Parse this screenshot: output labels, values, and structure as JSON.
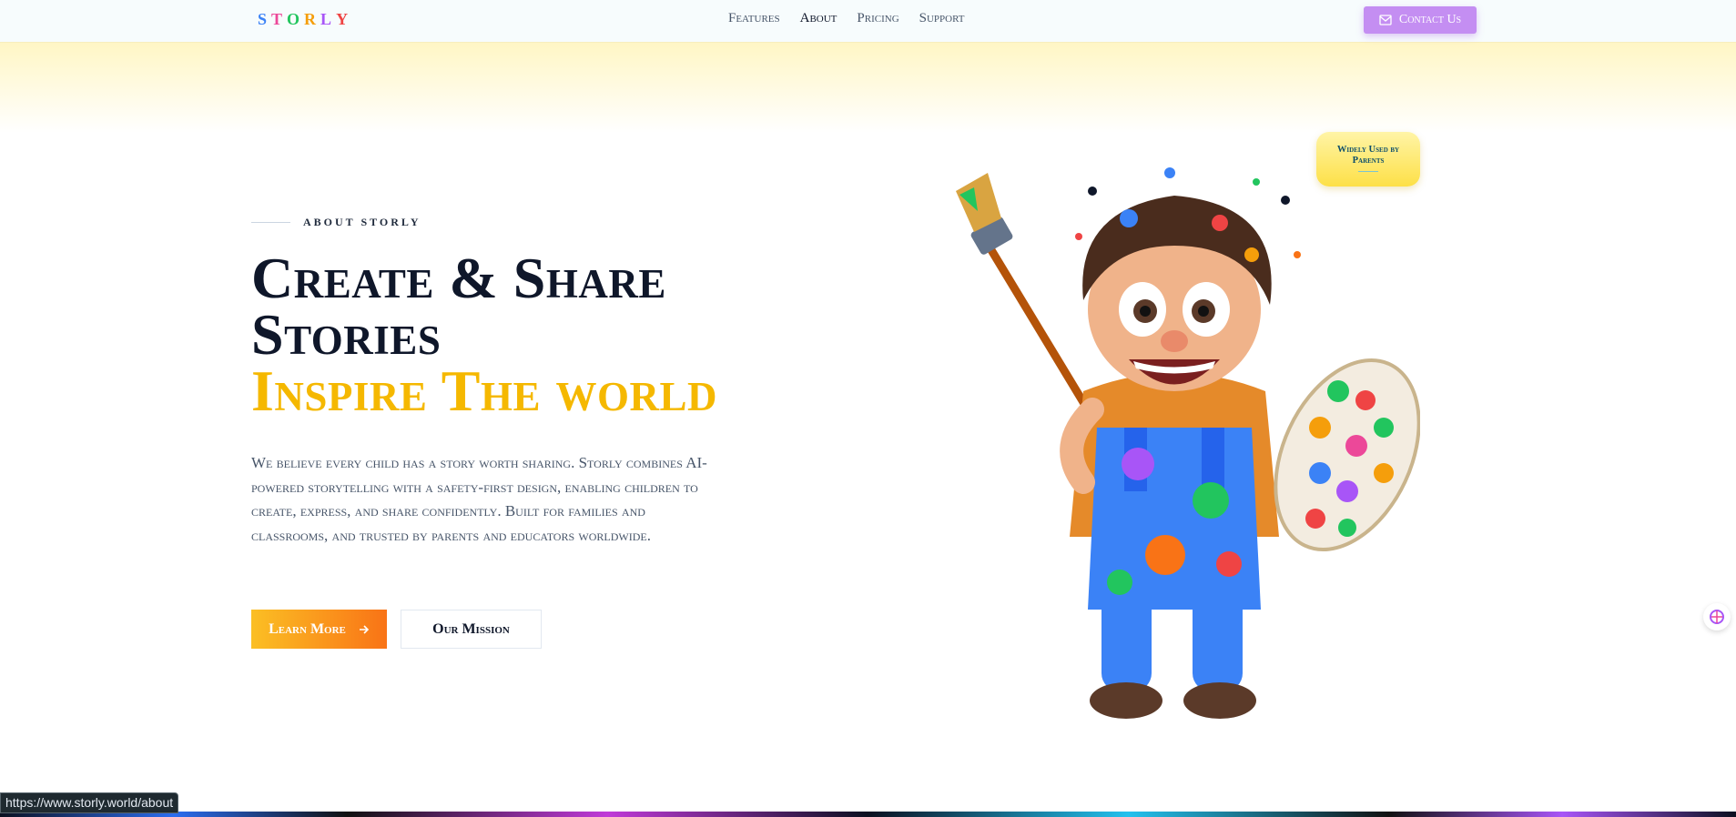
{
  "nav": {
    "logo_letters": [
      "S",
      "T",
      "O",
      "R",
      "L",
      "Y"
    ],
    "logo_colors": [
      "#3b82f6",
      "#ec4899",
      "#22c55e",
      "#f59e0b",
      "#a855f7",
      "#ef4444"
    ],
    "links": [
      {
        "label": "Features"
      },
      {
        "label": "About"
      },
      {
        "label": "Pricing"
      },
      {
        "label": "Support"
      }
    ],
    "contact_label": "Contact Us"
  },
  "hero": {
    "eyebrow": "ABOUT STORLY",
    "title_line1": "Create & Share",
    "title_line2": "Stories",
    "title_line3": "Inspire The world",
    "description": "We believe every child has a story worth sharing. Storly combines AI-powered storytelling with a safety-first design, enabling children to create, express, and share confidently. Built for families and classrooms, and trusted by parents and educators worldwide.",
    "learn_more": "Learn More",
    "our_mission": "Our Mission",
    "badge_line1": "Widely Used by",
    "badge_line2": "Parents"
  },
  "status_url": "https://www.storly.world/about",
  "colors": {
    "accent_gold": "#f5b800",
    "brand_purple": "#c48ef2",
    "dark": "#0f172a"
  }
}
